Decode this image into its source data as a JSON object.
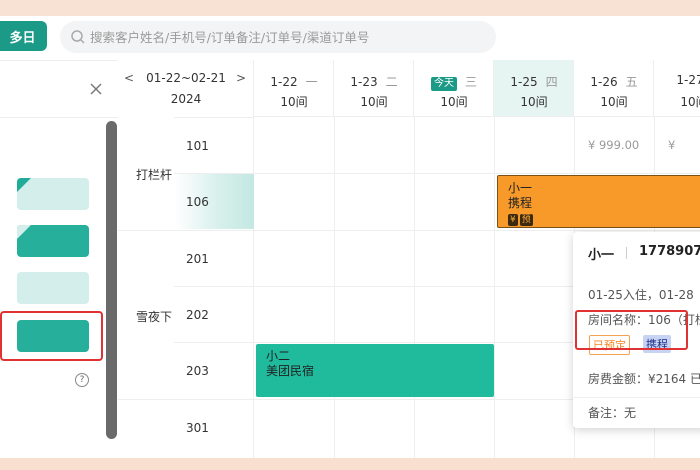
{
  "header": {
    "view_label": "多日",
    "search_placeholder": "搜索客户姓名/手机号/订单备注/订单号/渠道订单号"
  },
  "room_column": {
    "date_range": "01-22~02-21",
    "year": "2024",
    "groups": [
      {
        "label": "打栏杆",
        "rooms": [
          "101",
          "106"
        ]
      },
      {
        "label": "雪夜下",
        "rooms": [
          "201",
          "202",
          "203"
        ]
      }
    ],
    "extra_room": "301"
  },
  "days": [
    {
      "date": "1-22",
      "week": "一",
      "rooms": "10间",
      "today": false,
      "selected": false
    },
    {
      "date": "1-23",
      "week": "二",
      "rooms": "10间",
      "today": false,
      "selected": false
    },
    {
      "date": "今天",
      "week": "三",
      "rooms": "10间",
      "today": true,
      "selected": false
    },
    {
      "date": "1-25",
      "week": "四",
      "rooms": "10间",
      "today": false,
      "selected": true
    },
    {
      "date": "1-26",
      "week": "五",
      "rooms": "10间",
      "today": false,
      "selected": false
    },
    {
      "date": "1-27",
      "week": "",
      "rooms": "10间",
      "today": false,
      "selected": false
    }
  ],
  "prices": [
    "¥ 999.00",
    "¥"
  ],
  "bookings": {
    "orange": {
      "name": "小一",
      "channel": "携程",
      "badge_money": "¥",
      "badge_pre": "预"
    },
    "green": {
      "name": "小二",
      "channel": "美团民宿"
    }
  },
  "popover": {
    "name": "小一",
    "phone": "1778907",
    "stay": "01-25入住，01-28",
    "room": "房间名称：106（打栏",
    "status_tag": "已预定",
    "channel_tag": "携程",
    "amount": "房费金额：¥2164 已",
    "note": "备注：无"
  },
  "colors": {
    "primary": "#1b9a87",
    "booking_orange": "#f79a2a",
    "booking_green": "#1fbb9c",
    "highlight_red": "#e03232"
  }
}
